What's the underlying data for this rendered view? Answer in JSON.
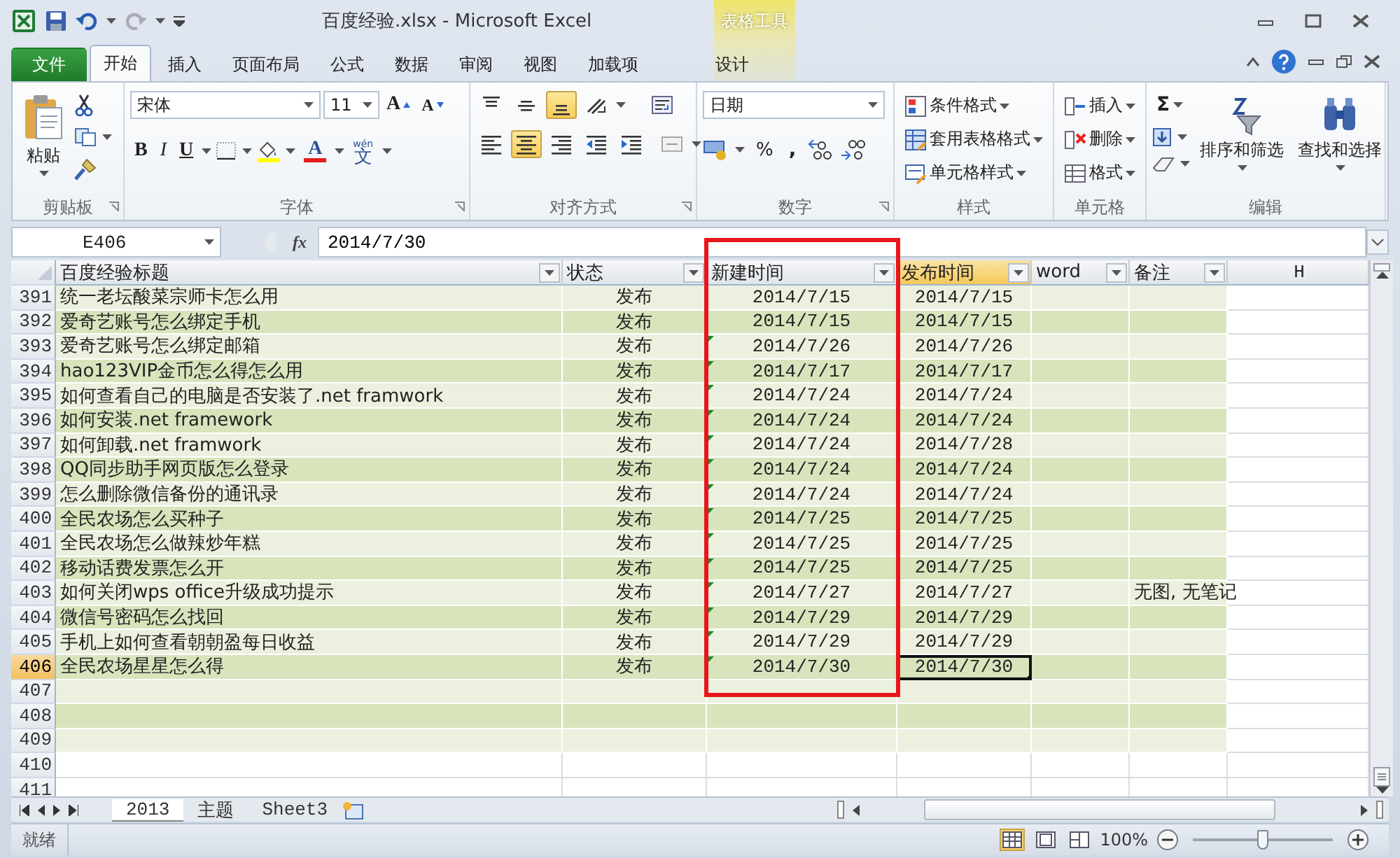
{
  "window": {
    "title": "百度经验.xlsx  -  Microsoft Excel",
    "context_group": "表格工具"
  },
  "tabs": [
    {
      "label": "文件",
      "kind": "file",
      "selected": false
    },
    {
      "label": "开始",
      "kind": "tab",
      "selected": true
    },
    {
      "label": "插入",
      "kind": "tab",
      "selected": false
    },
    {
      "label": "页面布局",
      "kind": "tab",
      "selected": false
    },
    {
      "label": "公式",
      "kind": "tab",
      "selected": false
    },
    {
      "label": "数据",
      "kind": "tab",
      "selected": false
    },
    {
      "label": "审阅",
      "kind": "tab",
      "selected": false
    },
    {
      "label": "视图",
      "kind": "tab",
      "selected": false
    },
    {
      "label": "加载项",
      "kind": "tab",
      "selected": false
    },
    {
      "label": "设计",
      "kind": "context",
      "selected": false
    }
  ],
  "ribbon": [
    {
      "kind": "clipboard",
      "label": "剪贴板",
      "paste": "粘贴",
      "launcher": true
    },
    {
      "kind": "font",
      "label": "字体",
      "font": "宋体",
      "size": "11",
      "grow": "A",
      "shrink": "A",
      "bold": "B",
      "italic": "I",
      "underline": "U",
      "font_color": "A",
      "phonetic": "文",
      "phonetic_ruby": "wén",
      "launcher": true
    },
    {
      "kind": "alignment",
      "label": "对齐方式",
      "launcher": true,
      "buttons": [
        {
          "kind": "top",
          "selected": false
        },
        {
          "kind": "middle",
          "selected": false
        },
        {
          "kind": "bottom",
          "selected": true
        },
        {
          "kind": "orientation",
          "selected": false
        },
        {
          "kind": "wrap",
          "selected": false
        },
        {
          "kind": "left",
          "selected": false
        },
        {
          "kind": "center",
          "selected": true
        },
        {
          "kind": "right",
          "selected": false
        },
        {
          "kind": "outdent",
          "selected": false
        },
        {
          "kind": "indent",
          "selected": false
        },
        {
          "kind": "merge",
          "selected": false
        }
      ]
    },
    {
      "kind": "number",
      "label": "数字",
      "format": "日期",
      "percent": "%",
      "comma": ",",
      "launcher": true
    },
    {
      "kind": "styles",
      "label": "样式",
      "items": [
        {
          "kind": "conditional",
          "label": "条件格式"
        },
        {
          "kind": "table",
          "label": "套用表格格式"
        },
        {
          "kind": "cell",
          "label": "单元格样式"
        }
      ]
    },
    {
      "kind": "cells",
      "label": "单元格",
      "items": [
        {
          "kind": "insert",
          "label": "插入"
        },
        {
          "kind": "delete",
          "label": "删除"
        },
        {
          "kind": "format",
          "label": "格式"
        }
      ]
    },
    {
      "kind": "editing",
      "label": "编辑",
      "sum": "Σ",
      "sort": "排序和筛选",
      "find": "查找和选择"
    }
  ],
  "formula_bar": {
    "name_box": "E406",
    "fx": "fx",
    "value": "2014/7/30"
  },
  "columns": [
    {
      "label": "百度经验标题",
      "kind": "table_header",
      "selected": false
    },
    {
      "label": "状态",
      "kind": "table_header",
      "selected": false
    },
    {
      "label": "新建时间",
      "kind": "table_header",
      "selected": false
    },
    {
      "label": "发布时间",
      "kind": "table_header",
      "selected": true
    },
    {
      "label": "word",
      "kind": "table_header",
      "selected": false
    },
    {
      "label": "备注",
      "kind": "table_header",
      "selected": false
    },
    {
      "label": "H",
      "kind": "letter",
      "selected": false
    }
  ],
  "rows": [
    {
      "num": "391",
      "in_table": true,
      "selected": false,
      "title": "统一老坛酸菜宗师卡怎么用",
      "status": "发布",
      "created": "2014/7/15",
      "published": "2014/7/15",
      "error_flag": false
    },
    {
      "num": "392",
      "in_table": true,
      "selected": false,
      "title": "爱奇艺账号怎么绑定手机",
      "status": "发布",
      "created": "2014/7/15",
      "published": "2014/7/15",
      "error_flag": false
    },
    {
      "num": "393",
      "in_table": true,
      "selected": false,
      "title": "爱奇艺账号怎么绑定邮箱",
      "status": "发布",
      "created": "2014/7/26",
      "published": "2014/7/26",
      "error_flag": true
    },
    {
      "num": "394",
      "in_table": true,
      "selected": false,
      "title": "hao123VIP金币怎么得怎么用",
      "status": "发布",
      "created": "2014/7/17",
      "published": "2014/7/17",
      "error_flag": true
    },
    {
      "num": "395",
      "in_table": true,
      "selected": false,
      "title": "如何查看自己的电脑是否安装了.net framwork",
      "status": "发布",
      "created": "2014/7/24",
      "published": "2014/7/24",
      "error_flag": true
    },
    {
      "num": "396",
      "in_table": true,
      "selected": false,
      "title": "如何安装.net framework",
      "status": "发布",
      "created": "2014/7/24",
      "published": "2014/7/24",
      "error_flag": true
    },
    {
      "num": "397",
      "in_table": true,
      "selected": false,
      "title": "如何卸载.net framwork",
      "status": "发布",
      "created": "2014/7/24",
      "published": "2014/7/28",
      "error_flag": true
    },
    {
      "num": "398",
      "in_table": true,
      "selected": false,
      "title": "QQ同步助手网页版怎么登录",
      "status": "发布",
      "created": "2014/7/24",
      "published": "2014/7/24",
      "error_flag": true
    },
    {
      "num": "399",
      "in_table": true,
      "selected": false,
      "title": "怎么删除微信备份的通讯录",
      "status": "发布",
      "created": "2014/7/24",
      "published": "2014/7/24",
      "error_flag": true
    },
    {
      "num": "400",
      "in_table": true,
      "selected": false,
      "title": "全民农场怎么买种子",
      "status": "发布",
      "created": "2014/7/25",
      "published": "2014/7/25",
      "error_flag": true
    },
    {
      "num": "401",
      "in_table": true,
      "selected": false,
      "title": "全民农场怎么做辣炒年糕",
      "status": "发布",
      "created": "2014/7/25",
      "published": "2014/7/25",
      "error_flag": true
    },
    {
      "num": "402",
      "in_table": true,
      "selected": false,
      "title": "移动话费发票怎么开",
      "status": "发布",
      "created": "2014/7/25",
      "published": "2014/7/25",
      "error_flag": true
    },
    {
      "num": "403",
      "in_table": true,
      "selected": false,
      "title": "如何关闭wps office升级成功提示",
      "status": "发布",
      "created": "2014/7/27",
      "published": "2014/7/27",
      "note": "无图, 无笔记",
      "error_flag": true
    },
    {
      "num": "404",
      "in_table": true,
      "selected": false,
      "title": "微信号密码怎么找回",
      "status": "发布",
      "created": "2014/7/29",
      "published": "2014/7/29",
      "error_flag": true
    },
    {
      "num": "405",
      "in_table": true,
      "selected": false,
      "title": "手机上如何查看朝朝盈每日收益",
      "status": "发布",
      "created": "2014/7/29",
      "published": "2014/7/29",
      "error_flag": true
    },
    {
      "num": "406",
      "in_table": true,
      "selected": true,
      "title": "全民农场星星怎么得",
      "status": "发布",
      "created": "2014/7/30",
      "published": "2014/7/30",
      "error_flag": true
    },
    {
      "num": "407",
      "in_table": true,
      "selected": false
    },
    {
      "num": "408",
      "in_table": true,
      "selected": false
    },
    {
      "num": "409",
      "in_table": true,
      "selected": false
    },
    {
      "num": "410",
      "in_table": false,
      "selected": false
    },
    {
      "num": "411",
      "in_table": false,
      "selected": false
    }
  ],
  "sheet_tabs": [
    {
      "label": "2013",
      "selected": true
    },
    {
      "label": "主题",
      "selected": false
    },
    {
      "label": "Sheet3",
      "selected": false
    }
  ],
  "status_bar": {
    "status": "就绪",
    "views": [
      {
        "kind": "normal",
        "selected": true
      },
      {
        "kind": "page_layout",
        "selected": false
      },
      {
        "kind": "page_break",
        "selected": false
      }
    ],
    "zoom": "100%",
    "zoom_slider": {
      "level": 0.5
    }
  }
}
